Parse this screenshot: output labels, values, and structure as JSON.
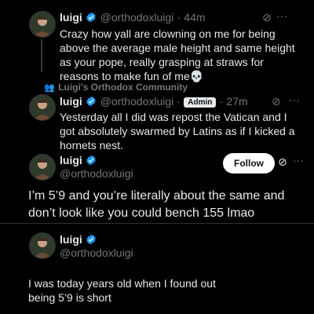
{
  "tweet1": {
    "name": "luigi",
    "handle": "@orthodoxluigi",
    "time": "· 44m",
    "text": "Crazy how yall are clowning on me for being above the average male height and same height as your pope, really grasping at straws for reasons to make fun of me💀"
  },
  "community": {
    "label": "Luigi's Orthodox Community"
  },
  "tweet2": {
    "name": "luigi",
    "handle": "@orthodoxluigi ·",
    "role": "Admin",
    "time": "· 27m",
    "text": "Yesterday all I did was repost the Vatican and I got absolutely swarmed by Latins as if I kicked a hornets nest."
  },
  "tweet3": {
    "name": "luigi",
    "handle": "@orthodoxluigi",
    "follow_label": "Follow",
    "text": "I’m 5’9 and you’re literally about the same and don’t look like you could bench 155 lmao"
  },
  "tweet4": {
    "name": "luigi",
    "handle": "@orthodoxluigi",
    "text": "I was today years old when I found out being 5’9 is short"
  },
  "colors": {
    "verified": "#1d9bf0",
    "muted": "#71767b",
    "background": "#000000"
  }
}
